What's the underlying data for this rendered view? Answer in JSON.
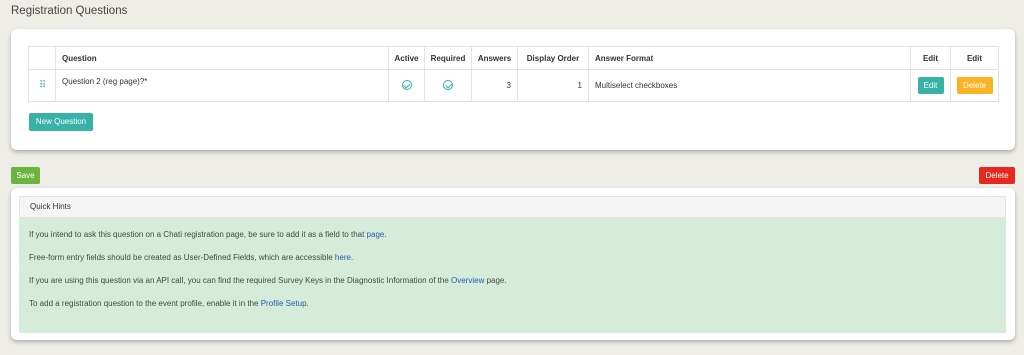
{
  "page": {
    "title": "Registration Questions"
  },
  "table": {
    "headers": {
      "question": "Question",
      "active": "Active",
      "required": "Required",
      "answers": "Answers",
      "display_order": "Display Order",
      "answer_format": "Answer Format",
      "edit1": "Edit",
      "edit2": "Edit"
    },
    "rows": [
      {
        "drag": "⠿",
        "question": "Question 2 (reg page)?*",
        "active": true,
        "required": true,
        "answers": "3",
        "display_order": "1",
        "answer_format": "Multiselect checkboxes",
        "edit_label": "Edit",
        "delete_label": "Delete"
      }
    ]
  },
  "buttons": {
    "new_question": "New Question",
    "save": "Save",
    "delete": "Delete"
  },
  "colors": {
    "teal": "#38b2a6",
    "orange": "#f9b324",
    "green": "#6cb33f",
    "red": "#e8281e",
    "hint_bg": "#d6ecdb",
    "link": "#1f5ea8"
  },
  "hints": {
    "title": "Quick Hints",
    "lines": [
      {
        "pre": "If you intend to ask this question on a Chati registration page, be sure to add it as a field to that ",
        "link": "page",
        "post": "."
      },
      {
        "pre": "Free-form entry fields should be created as User-Defined Fields, which are accessible ",
        "link": "here",
        "post": "."
      },
      {
        "pre": "If you are using this question via an API call, you can find the required Survey Keys in the Diagnostic Information of the ",
        "link": "Overview",
        "post": " page."
      },
      {
        "pre": "To add a registration question to the event profile, enable it in the ",
        "link": "Profile Setup",
        "post": "."
      }
    ]
  }
}
